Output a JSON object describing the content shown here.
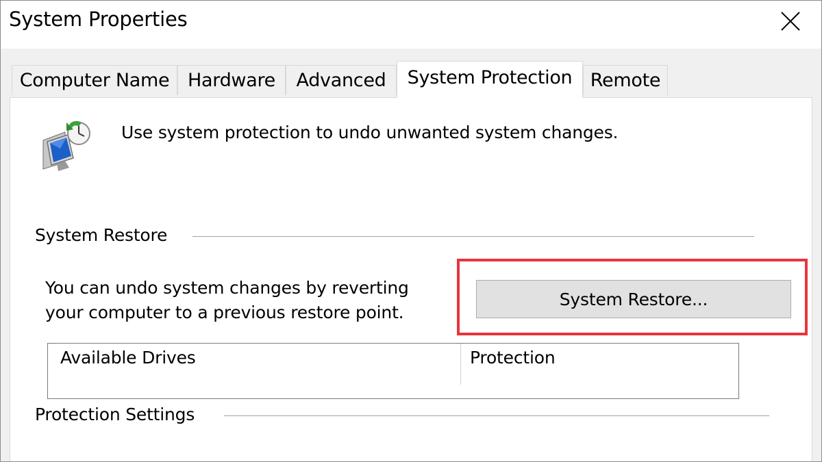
{
  "window": {
    "title": "System Properties",
    "close_glyph": "✕"
  },
  "tabs": [
    {
      "label": "Computer Name",
      "active": false
    },
    {
      "label": "Hardware",
      "active": false
    },
    {
      "label": "Advanced",
      "active": false
    },
    {
      "label": "System Protection",
      "active": true
    },
    {
      "label": "Remote",
      "active": false
    }
  ],
  "intro": {
    "icon": "system-protection-icon",
    "text": "Use system protection to undo unwanted system changes."
  },
  "system_restore": {
    "group_label": "System Restore",
    "description_line1": "You can undo system changes by reverting",
    "description_line2": "your computer to a previous restore point.",
    "button_label": "System Restore...",
    "highlight_color": "#e8343b"
  },
  "protection_settings": {
    "group_label": "Protection Settings",
    "columns": [
      "Available Drives",
      "Protection"
    ]
  }
}
